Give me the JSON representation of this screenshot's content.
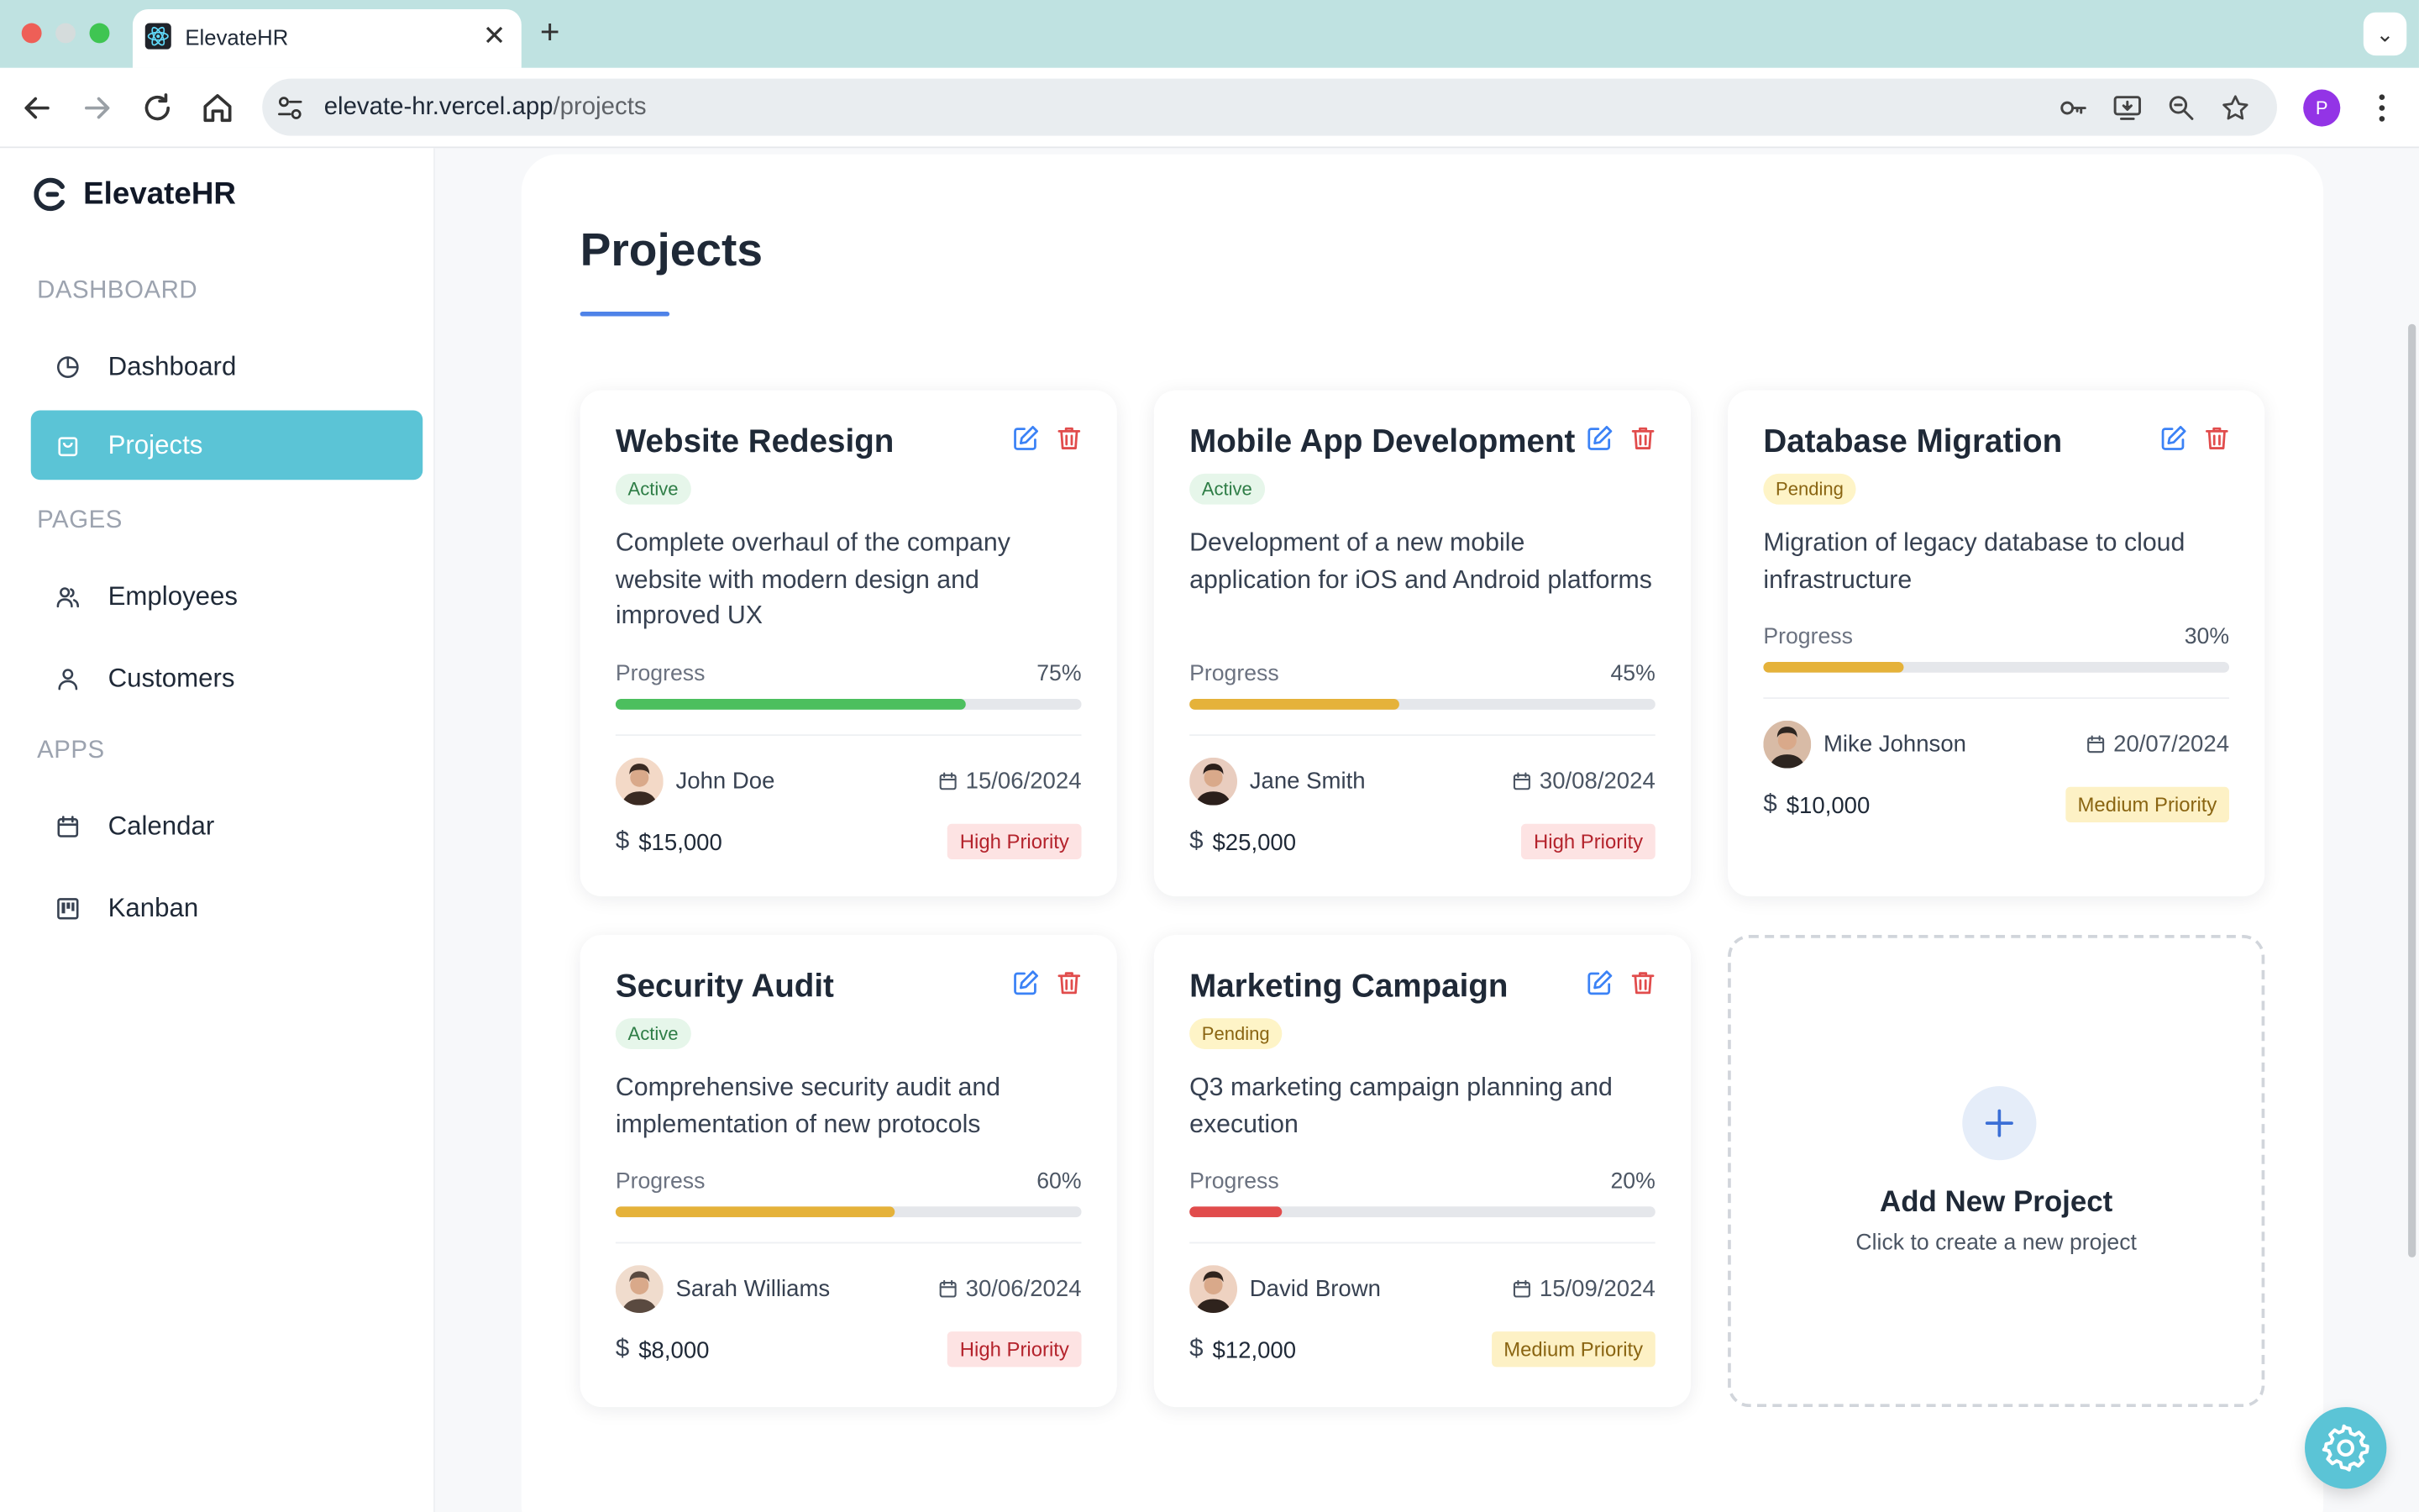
{
  "browser": {
    "tab_title": "ElevateHR",
    "url_host": "elevate-hr.vercel.app",
    "url_path": "/projects",
    "profile_initial": "P"
  },
  "brand": {
    "name": "ElevateHR"
  },
  "sidebar": {
    "sections": [
      {
        "label": "DASHBOARD",
        "items": [
          {
            "label": "Dashboard",
            "icon": "pie-chart-icon",
            "active": false
          },
          {
            "label": "Projects",
            "icon": "shopping-bag-icon",
            "active": true
          }
        ]
      },
      {
        "label": "PAGES",
        "items": [
          {
            "label": "Employees",
            "icon": "users-icon",
            "active": false
          },
          {
            "label": "Customers",
            "icon": "user-icon",
            "active": false
          }
        ]
      },
      {
        "label": "APPS",
        "items": [
          {
            "label": "Calendar",
            "icon": "calendar-icon",
            "active": false
          },
          {
            "label": "Kanban",
            "icon": "kanban-icon",
            "active": false
          }
        ]
      }
    ]
  },
  "page": {
    "title": "Projects"
  },
  "projects": [
    {
      "title": "Website Redesign",
      "status": "Active",
      "description": "Complete overhaul of the company website with modern design and improved UX",
      "progress_label": "Progress",
      "progress": "75%",
      "progress_value": 0.75,
      "progress_color": "#4cbf5e",
      "owner": "John Doe",
      "date": "15/06/2024",
      "budget": "$15,000",
      "priority": "High Priority"
    },
    {
      "title": "Mobile App Development",
      "status": "Active",
      "description": "Development of a new mobile application for iOS and Android platforms",
      "progress_label": "Progress",
      "progress": "45%",
      "progress_value": 0.45,
      "progress_color": "#e5b23a",
      "owner": "Jane Smith",
      "date": "30/08/2024",
      "budget": "$25,000",
      "priority": "High Priority"
    },
    {
      "title": "Database Migration",
      "status": "Pending",
      "description": "Migration of legacy database to cloud infrastructure",
      "progress_label": "Progress",
      "progress": "30%",
      "progress_value": 0.3,
      "progress_color": "#e5b23a",
      "owner": "Mike Johnson",
      "date": "20/07/2024",
      "budget": "$10,000",
      "priority": "Medium Priority"
    },
    {
      "title": "Security Audit",
      "status": "Active",
      "description": "Comprehensive security audit and implementation of new protocols",
      "progress_label": "Progress",
      "progress": "60%",
      "progress_value": 0.6,
      "progress_color": "#e5b23a",
      "owner": "Sarah Williams",
      "date": "30/06/2024",
      "budget": "$8,000",
      "priority": "High Priority"
    },
    {
      "title": "Marketing Campaign",
      "status": "Pending",
      "description": "Q3 marketing campaign planning and execution",
      "progress_label": "Progress",
      "progress": "20%",
      "progress_value": 0.2,
      "progress_color": "#e14c4c",
      "owner": "David Brown",
      "date": "15/09/2024",
      "budget": "$12,000",
      "priority": "Medium Priority"
    }
  ],
  "add_project": {
    "title": "Add New Project",
    "subtitle": "Click to create a new project"
  },
  "colors": {
    "accent": "#5bc4d6",
    "edit": "#3b82f6",
    "delete": "#e14c4c"
  }
}
